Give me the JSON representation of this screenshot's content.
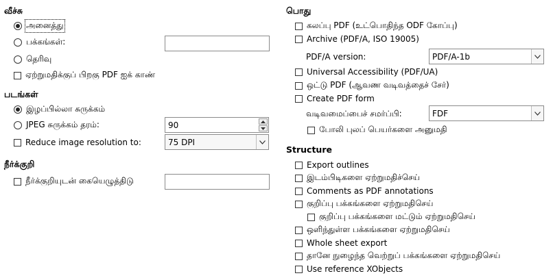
{
  "left": {
    "images_section": {
      "title": "வீச்சு"
    },
    "range_all": "அனைத்து",
    "range_pages": "பக்கங்கள்:",
    "range_pages_value": "",
    "range_selection": "தெரிவு",
    "view_after_export": "ஏற்றுமதிக்குப் பிறகு PDF ஐக் காண்",
    "pictures_section": {
      "title": "படங்கள்"
    },
    "lossless": "இழப்பில்லா சுருக்கம்",
    "jpeg": "JPEG சுருக்கம்  தரம்:",
    "jpeg_quality": "90",
    "reduce_resolution": "Reduce image resolution to:",
    "resolution_value": "75 DPI",
    "watermark_section": {
      "title": "நீர்க்குறி"
    },
    "sign_watermark": "நீர்க்குறியுடன் கையெழுத்திடு",
    "watermark_value": ""
  },
  "right": {
    "general_section": {
      "title": "பொது"
    },
    "hybrid_pdf": "கலப்பு PDF (உட்பொதிந்த ODF கோப்பு)",
    "archive": "Archive (PDF/A, ISO 19005)",
    "pdfa_version_label": "PDF/A version:",
    "pdfa_version_value": "PDF/A-1b",
    "universal_accessibility": "Universal Accessibility (PDF/UA)",
    "tagged_pdf": "ஒட்டு PDF (ஆவண வடிவத்தைச் சேர்)",
    "create_form": "Create PDF form",
    "submit_format_label": "வடிவமைப்பைச் சமர்ப்பி:",
    "submit_format_value": "FDF",
    "allow_duplicate": "போலி புலப் பெயர்களை அனுமதி",
    "structure_section": {
      "title": "Structure"
    },
    "export_outlines": "Export outlines",
    "export_placeholders": "இடம்பிடிகளை ஏற்றுமதிச்செய்",
    "comments_as_annotations": "Comments as PDF annotations",
    "export_notes": "குறிப்பு பக்கங்களை ஏற்றுமதிசெய்",
    "export_only_notes": "குறிப்பு பக்கங்களை மட்டும் ஏற்றுமதிசெய்",
    "export_hidden": "ஒளிந்துள்ள பக்கங்களை ஏற்றுமதிசெய்",
    "whole_sheet": "Whole sheet export",
    "export_blank": "தானே நுழைந்த வெற்றுப் பக்கங்களை ஏற்றுமதிசெய்",
    "use_xobjects": "Use reference XObjects"
  },
  "icons": {
    "dropdown": "chevron-down-icon",
    "spin_up": "triangle-up-icon",
    "spin_down": "triangle-down-icon"
  }
}
